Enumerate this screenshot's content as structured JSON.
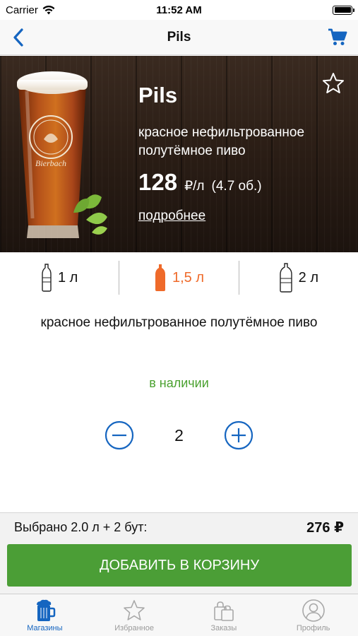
{
  "status_bar": {
    "carrier": "Carrier",
    "time": "11:52 AM",
    "battery_level": 1.0
  },
  "nav": {
    "title": "Pils"
  },
  "product": {
    "name": "Pils",
    "description": "красное нефильтрованное полутёмное пиво",
    "price": "128",
    "price_unit": "₽/л",
    "abv": "(4.7 об.)",
    "more_link": "подробнее",
    "glass_logo_text": "Bierbach"
  },
  "volumes": [
    {
      "label": "1 л",
      "selected": false
    },
    {
      "label": "1,5 л",
      "selected": true
    },
    {
      "label": "2 л",
      "selected": false
    }
  ],
  "details": {
    "description": "красное нефильтрованное полутёмное пиво",
    "availability": "в наличии"
  },
  "stepper": {
    "value": "2"
  },
  "summary": {
    "selected_text": "Выбрано 2.0 л + 2 бут:",
    "total": "276 ₽"
  },
  "add_button": {
    "label": "ДОБАВИТЬ В КОРЗИНУ"
  },
  "tabs": [
    {
      "label": "Магазины",
      "icon": "beer-mug-icon",
      "active": true
    },
    {
      "label": "Избранное",
      "icon": "star-icon",
      "active": false
    },
    {
      "label": "Заказы",
      "icon": "shopping-bags-icon",
      "active": false
    },
    {
      "label": "Профиль",
      "icon": "profile-icon",
      "active": false
    }
  ],
  "colors": {
    "accent_blue": "#1565c0",
    "selected_orange": "#ef6a2a",
    "available_green": "#4aa12f",
    "button_green": "#4b9e36"
  }
}
